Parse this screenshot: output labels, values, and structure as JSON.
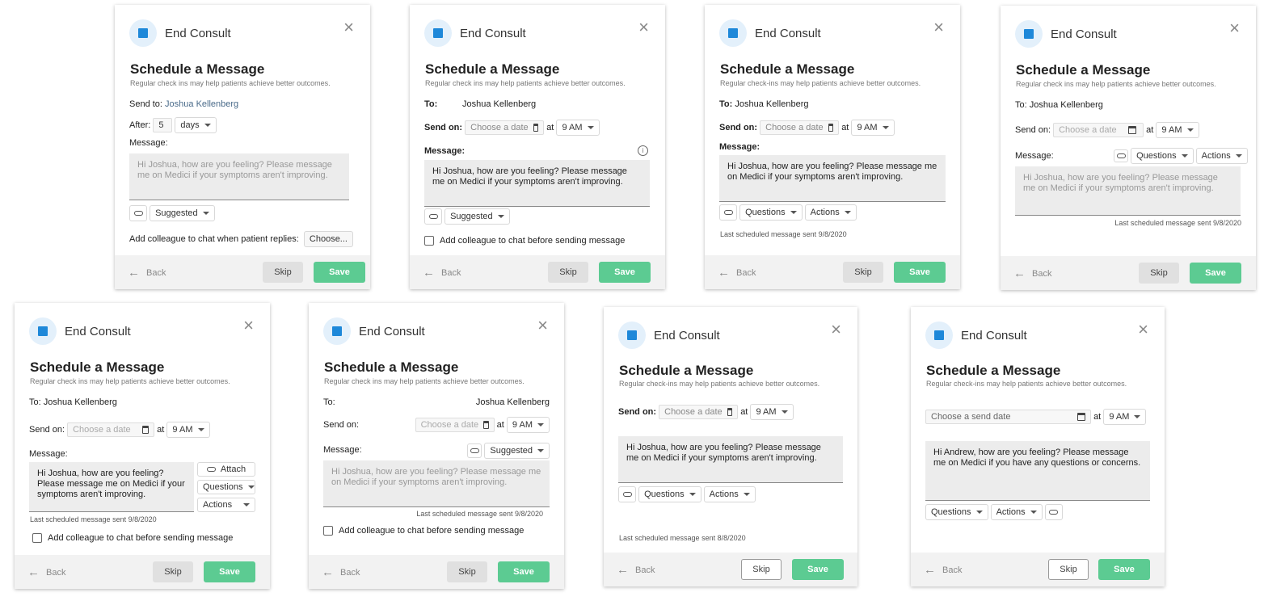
{
  "common": {
    "header_title": "End Consult",
    "title": "Schedule a Message",
    "sub_ins": "Regular check ins may help patients achieve better outcomes.",
    "sub_dash": "Regular check-ins may help patients achieve better outcomes.",
    "back": "Back",
    "skip": "Skip",
    "save": "Save",
    "close": "×",
    "at": "at",
    "time": "9 AM",
    "choose_date": "Choose a date",
    "patient": "Joshua Kellenberg",
    "msg_joshua": "Hi Joshua, how are you feeling? Please message me on Medici if your symptoms aren't improving.",
    "msg_joshua_narrow": "Hi Joshua, how are you feeling? Please message me on Medici if your symptoms aren't improving.",
    "suggested": "Suggested",
    "questions": "Questions",
    "actions": "Actions",
    "last_sent": "Last scheduled message sent 9/8/2020",
    "add_colleague_before": "Add colleague to chat before sending message"
  },
  "c1": {
    "send_to_label": "Send to:",
    "after_label": "After:",
    "after_value": "5",
    "after_unit": "days",
    "message_label": "Message:",
    "add_colleague": "Add colleague to chat when patient replies:",
    "choose": "Choose..."
  },
  "c2": {
    "to_label": "To:",
    "send_on": "Send on:",
    "message_label": "Message:"
  },
  "c3": {
    "to_label": "To:",
    "send_on": "Send on:",
    "message_label": "Message:"
  },
  "c4": {
    "to_label": "To:",
    "send_on": "Send on:",
    "message_label": "Message:"
  },
  "c5": {
    "to_label": "To:",
    "send_on": "Send on:",
    "message_label": "Message:",
    "attach": "Attach"
  },
  "c6": {
    "to_label": "To:",
    "send_on": "Send on:",
    "message_label": "Message:"
  },
  "c7": {
    "send_on": "Send on:",
    "last_sent": "Last scheduled message sent 8/8/2020"
  },
  "c8": {
    "choose_send_date": "Choose a send date",
    "message": "Hi Andrew, how are you feeling? Please message me on Medici if you have any questions or concerns."
  }
}
